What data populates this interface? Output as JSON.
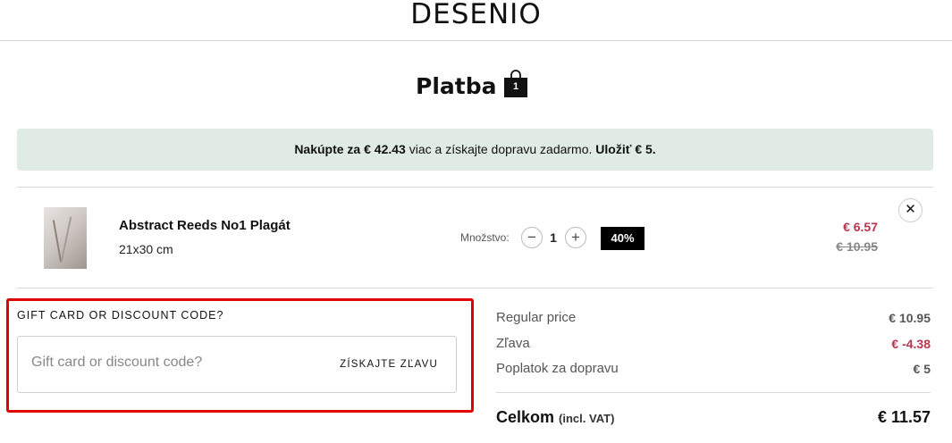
{
  "header": {
    "logo": "DESENIO"
  },
  "page": {
    "title": "Platba",
    "cart_count": "1"
  },
  "banner": {
    "prefix": "Nakúpte za",
    "amount": "€ 42.43",
    "middle": "viac a získajte dopravu zadarmo.",
    "save_label": "Uložiť € 5."
  },
  "cart_item": {
    "name": "Abstract Reeds No1 Plagát",
    "size": "21x30 cm",
    "quantity_label": "Množstvo:",
    "quantity": "1",
    "discount_badge": "40%",
    "price": "€ 6.57",
    "original_price": "€ 10.95"
  },
  "gift_card": {
    "title": "GIFT CARD OR DISCOUNT CODE?",
    "placeholder": "Gift card or discount code?",
    "apply_label": "ZÍSKAJTE ZĽAVU"
  },
  "summary": {
    "rows": [
      {
        "label": "Regular price",
        "value": "€ 10.95"
      },
      {
        "label": "Zľava",
        "value": "€ -4.38"
      },
      {
        "label": "Poplatok za dopravu",
        "value": "€ 5"
      }
    ],
    "total_label": "Celkom",
    "total_note": "(incl. VAT)",
    "total_value": "€ 11.57"
  },
  "colors": {
    "banner_bg": "#e0ebe6",
    "sale_red": "#b8344f",
    "highlight": "#e00000"
  }
}
